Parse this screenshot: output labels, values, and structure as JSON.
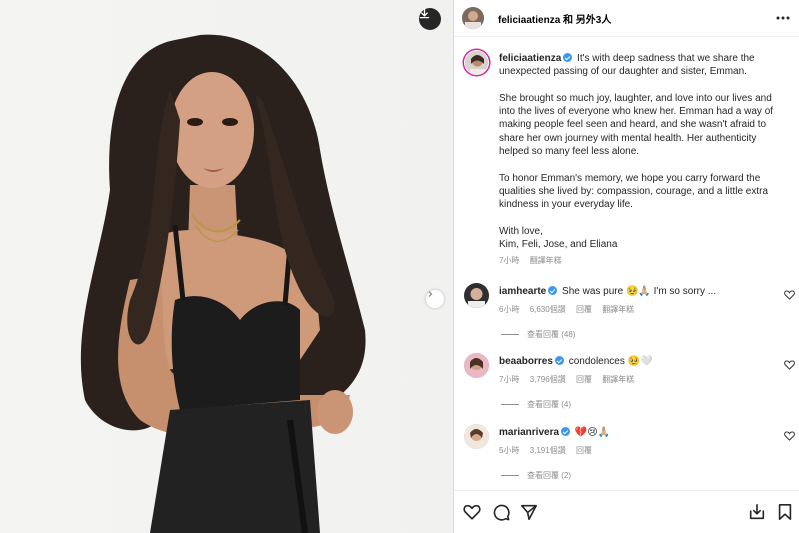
{
  "header": {
    "title": "feliciaatienza 和 另外3人"
  },
  "caption": {
    "username": "feliciaatienza",
    "paragraphs": [
      "It's with deep sadness that we share the unexpected passing of our daughter and sister, Emman.",
      "She brought so much joy, laughter, and love into our lives and into the lives of everyone who knew her. Emman had a way of making people feel seen and heard, and she wasn't afraid to share her own journey with mental health. Her authenticity helped so many feel less alone.",
      "To honor Emman's memory, we hope you carry forward the qualities she lived by: compassion, courage, and a little extra kindness in your everyday life.",
      "With love,"
    ],
    "signature": "Kim, Feli, Jose, and Eliana",
    "time": "7小時",
    "translate": "翻譯年糕"
  },
  "comments": [
    {
      "username": "iamhearte",
      "text": "She was pure 🥹🙏🏼 I'm so sorry ...",
      "time": "6小時",
      "likes": "6,630個讚",
      "reply": "回覆",
      "translate": "翻譯年糕",
      "view_replies": "查看回覆 (48)"
    },
    {
      "username": "beaaborres",
      "text": "condolences 🥹🤍",
      "time": "7小時",
      "likes": "3,796個讚",
      "reply": "回覆",
      "translate": "翻譯年糕",
      "view_replies": "查看回覆 (4)"
    },
    {
      "username": "marianrivera",
      "text": "💔😢🙏🏼",
      "time": "5小時",
      "likes": "3,191個讚",
      "reply": "回覆",
      "translate": "",
      "view_replies": "查看回覆 (2)"
    }
  ],
  "icons": {
    "download": "download-icon",
    "next": "chevron-right-icon",
    "more": "more-icon",
    "like": "heart-icon",
    "comment": "comment-icon",
    "share": "send-icon",
    "repost": "repost-icon",
    "save": "bookmark-icon"
  },
  "colors": {
    "verified": "#3897f0",
    "muted": "#8e8e8e",
    "story_ring": "#d6249f"
  }
}
